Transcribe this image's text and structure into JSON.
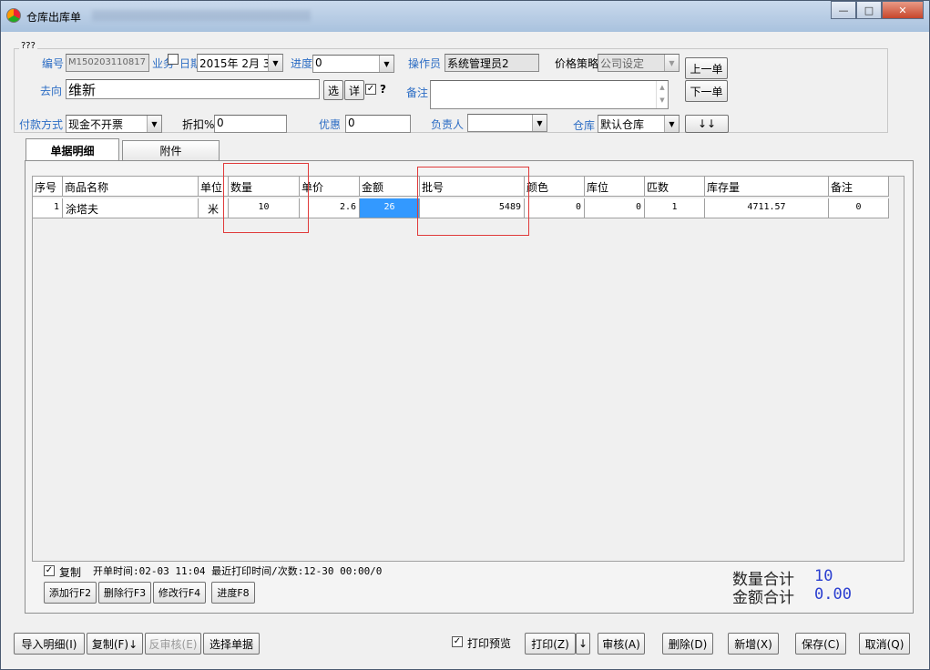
{
  "window": {
    "title": "仓库出库单",
    "caption": {
      "minimize": "—",
      "maximize": "□",
      "close": "✕"
    }
  },
  "header": {
    "group_title": "???",
    "bianhao_label": "编号",
    "bianhao_value": "M150203110817",
    "yewu_label": "业务",
    "riqi_label": "日期",
    "riqi_value": "2015年 2月 3",
    "jindu_label": "进度",
    "jindu_value": "0",
    "caozuoyuan_label": "操作员",
    "caozuoyuan_value": "系统管理员2",
    "jiage_label": "价格策略",
    "jiage_value": "公司设定",
    "prev_button": "上一单",
    "next_button": "下一单",
    "quxiang_label": "去向",
    "quxiang_value": "维新",
    "xuan_button": "选",
    "xiang_button": "详",
    "question_mark": "?",
    "beizhu_label": "备注",
    "beizhu_value": "",
    "fukuan_label": "付款方式",
    "fukuan_value": "现金不开票",
    "zhekou_label": "折扣%",
    "zhekou_value": "0",
    "youhui_label": "优惠",
    "youhui_value": "0",
    "fuzeren_label": "负责人",
    "fuzeren_value": "",
    "cangku_label": "仓库",
    "cangku_value": "默认仓库",
    "arrows_button": "↓↓"
  },
  "tabs": [
    {
      "label": "单据明细",
      "active": true
    },
    {
      "label": "附件",
      "active": false
    }
  ],
  "table": {
    "columns": [
      "序号",
      "商品名称",
      "单位",
      "数量",
      "单价",
      "金额",
      "批号",
      "颜色",
      "库位",
      "匹数",
      "库存量",
      "备注"
    ],
    "rows": [
      {
        "seq": "1",
        "name": "涂塔夫",
        "unit": "米",
        "qty": "10",
        "price": "2.6",
        "amount": "26",
        "batch": "5489",
        "color": "0",
        "location": "0",
        "pieces": "1",
        "stock": "4711.57",
        "remark": "0"
      }
    ]
  },
  "footer": {
    "copy_checkbox_label": "复制",
    "copy_checked": true,
    "status": "开单时间:02-03 11:04 最近打印时间/次数:12-30 00:00/0",
    "add_row": "添加行F2",
    "delete_row": "删除行F3",
    "edit_row": "修改行F4",
    "progress": "进度F8",
    "qty_total_label": "数量合计",
    "qty_total_value": "10",
    "amount_total_label": "金额合计",
    "amount_total_value": "0.00"
  },
  "bottom_bar": {
    "import_detail": "导入明细(I)",
    "copy": "复制(F)↓",
    "unaudit": "反审核(E)",
    "select_doc": "选择单据",
    "print_preview_label": "打印预览",
    "print_preview_checked": true,
    "print": "打印(Z)",
    "print_arrow": "↓",
    "audit": "审核(A)",
    "delete": "删除(D)",
    "new": "新增(X)",
    "save": "保存(C)",
    "cancel": "取消(Q)"
  }
}
